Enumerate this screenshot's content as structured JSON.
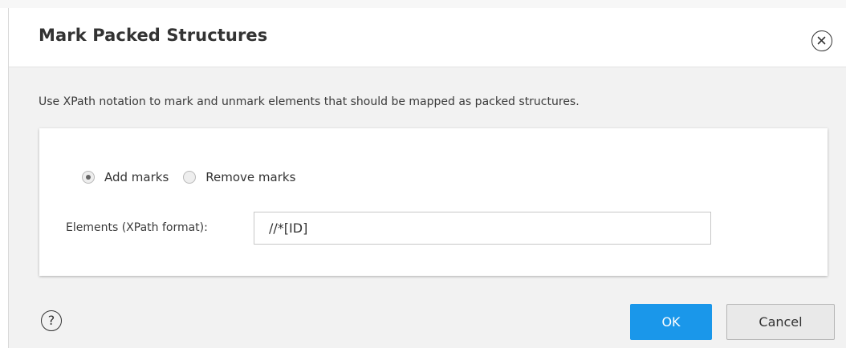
{
  "dialog": {
    "title": "Mark Packed Structures",
    "close_icon": "close-icon",
    "description": "Use XPath notation to mark and unmark elements that should be mapped as packed structures.",
    "mode_options": [
      {
        "label": "Add marks",
        "checked": true
      },
      {
        "label": "Remove marks",
        "checked": false
      }
    ],
    "elements_field": {
      "label": "Elements (XPath format):",
      "value": "//*[ID]"
    },
    "help_icon": "help-icon",
    "help_glyph": "?",
    "buttons": {
      "ok": "OK",
      "cancel": "Cancel"
    }
  },
  "colors": {
    "primary_button": "#1a97ea",
    "dialog_body": "#f2f2f2",
    "header": "#ffffff"
  }
}
